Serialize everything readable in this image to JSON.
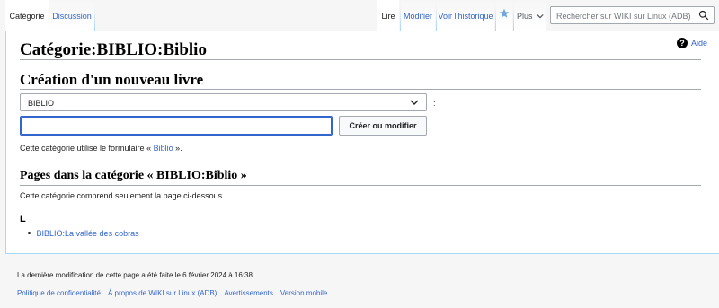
{
  "tabs": {
    "category": "Catégorie",
    "discussion": "Discussion",
    "read": "Lire",
    "edit": "Modifier",
    "history": "Voir l’historique",
    "more": "Plus"
  },
  "search": {
    "placeholder": "Rechercher sur WIKI sur Linux (ADB)"
  },
  "page": {
    "title": "Catégorie:BIBLIO:Biblio",
    "help": "Aide"
  },
  "create_book": {
    "heading": "Création d'un nouveau livre",
    "select_value": "BIBLIO",
    "colon": ":",
    "input_value": "",
    "button": "Créer ou modifier",
    "note_prefix": "Cette catégorie utilise le formulaire «",
    "note_link": "Biblio",
    "note_suffix": "»."
  },
  "pages_section": {
    "heading": "Pages dans la catégorie « BIBLIO:Biblio  »",
    "note": "Cette catégorie comprend seulement la page ci-dessous.",
    "letter": "L",
    "items": [
      {
        "label": "BIBLIO:La vallée des cobras"
      }
    ]
  },
  "footer": {
    "modified": "La dernière modification de cette page a été faite le 6 février 2024 à 16:38.",
    "links": [
      "Politique de confidentialité",
      "À propos de WIKI sur Linux (ADB)",
      "Avertissements",
      "Version mobile"
    ]
  },
  "colors": {
    "link": "#3366cc",
    "border": "#a7d7f9",
    "focus": "#3366cc"
  }
}
